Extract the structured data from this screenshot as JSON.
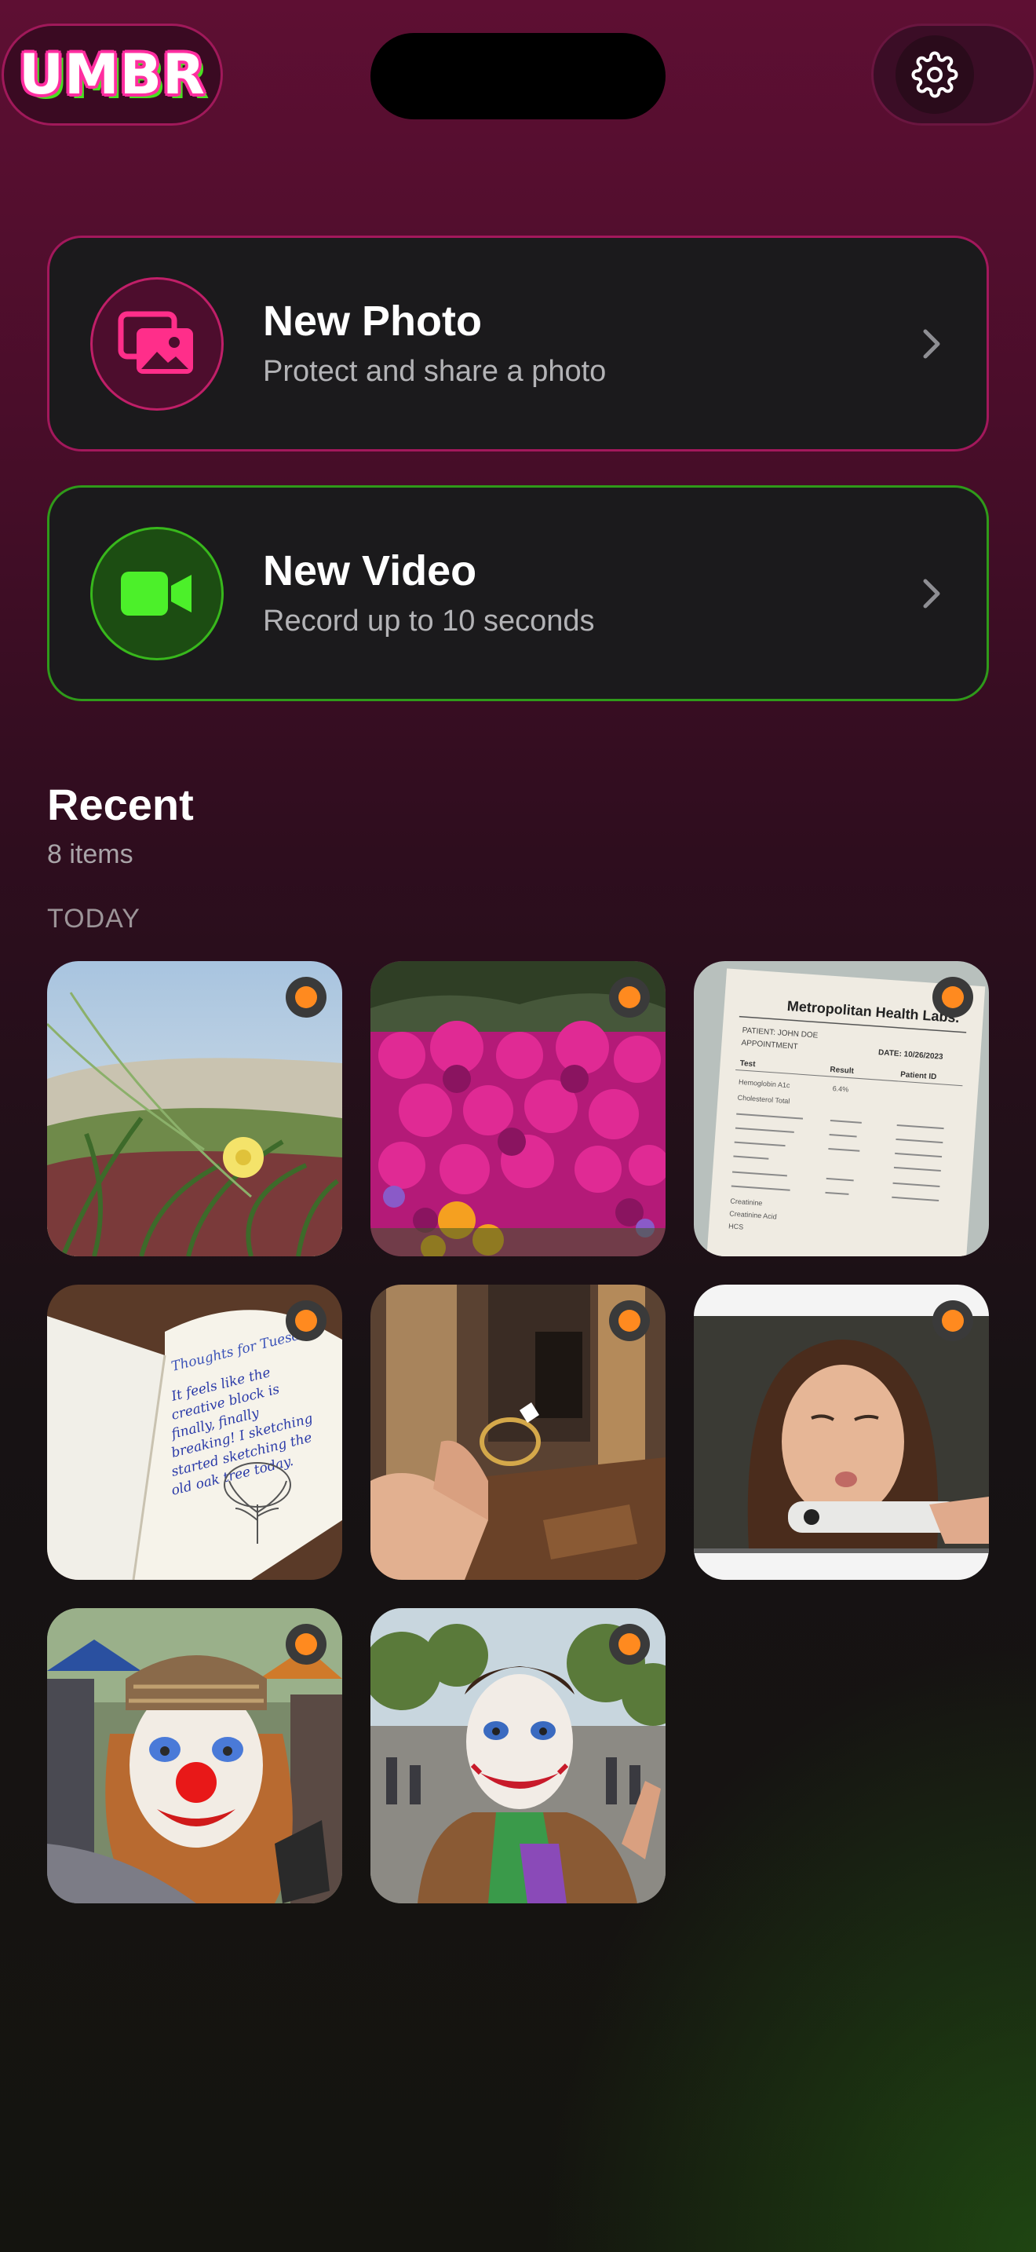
{
  "app": {
    "logo": "UMBR"
  },
  "header": {
    "settings_icon": "gear-icon"
  },
  "actions": [
    {
      "title": "New Photo",
      "subtitle": "Protect and share a photo",
      "icon": "photo-gallery-icon",
      "accent": "#c01f68"
    },
    {
      "title": "New Video",
      "subtitle": "Record up to 10 seconds",
      "icon": "video-camera-icon",
      "accent": "#38b81c"
    }
  ],
  "recent": {
    "title": "Recent",
    "count": "8 items",
    "section": "TODAY",
    "status_color": "#ff8a1f",
    "items": [
      {
        "subject": "dune grass with yellow flower"
      },
      {
        "subject": "magenta flower bed"
      },
      {
        "subject": "lab report",
        "lines": [
          "Metropolitan Health Labs.",
          "PATIENT: JOHN DOE",
          "APPOINTMENT",
          "DATE: 10/26/2023",
          "Test",
          "Result",
          "Patient ID",
          "Hemoglobin A1c",
          "6.4%",
          "Cholesterol Total",
          "Creatinine",
          "Creatinine Acid",
          "HCS"
        ]
      },
      {
        "subject": "handwritten notebook",
        "lines": [
          "Thoughts for Tuesday",
          "It feels like the",
          "creative block is",
          "finally, finally",
          "breaking! I sketching",
          "started sketching the",
          "old oak tree today."
        ]
      },
      {
        "subject": "engagement ring"
      },
      {
        "subject": "selfie winking woman"
      },
      {
        "subject": "clown face at market"
      },
      {
        "subject": "joker face at festival"
      }
    ]
  }
}
